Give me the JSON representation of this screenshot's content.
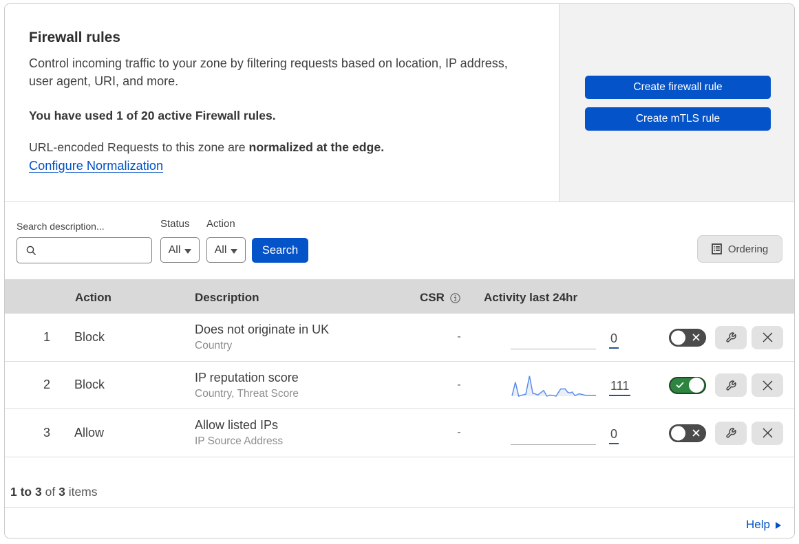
{
  "header": {
    "title": "Firewall rules",
    "description": "Control incoming traffic to your zone by filtering requests based on location, IP address,\nuser agent, URI, and more.",
    "usage_note": "You have used 1 of 20 active Firewall rules.",
    "normalization_prefix": "URL-encoded Requests to this zone are ",
    "normalization_bold": "normalized at the edge.",
    "normalization_link": "Configure Normalization",
    "create_firewall_button": "Create firewall rule",
    "create_mtls_button": "Create mTLS rule"
  },
  "filters": {
    "search_placeholder": "Search description...",
    "search_value": "",
    "status_label": "Status",
    "status_value": "All",
    "action_label": "Action",
    "action_value": "All",
    "search_button": "Search",
    "ordering_button": "Ordering"
  },
  "table": {
    "columns": {
      "action": "Action",
      "description": "Description",
      "csr": "CSR",
      "activity": "Activity last 24hr"
    },
    "rows": [
      {
        "index": "1",
        "action": "Block",
        "description": "Does not originate in UK",
        "criteria": "Country",
        "csr": "-",
        "activity_count": "0",
        "enabled": false
      },
      {
        "index": "2",
        "action": "Block",
        "description": "IP reputation score",
        "criteria": "Country, Threat Score",
        "csr": "-",
        "activity_count": "111",
        "enabled": true
      },
      {
        "index": "3",
        "action": "Allow",
        "description": "Allow listed IPs",
        "criteria": "IP Source Address",
        "csr": "-",
        "activity_count": "0",
        "enabled": false
      }
    ]
  },
  "chart_data": {
    "type": "area",
    "title": "Activity last 24hr sparkline for rule 2 (IP reputation score)",
    "x_range": [
      0,
      124
    ],
    "y_range": [
      0,
      35
    ],
    "baseline_y": 35,
    "line_color": "#5b8dea",
    "fill_color": "#e9eef7",
    "points": [
      [
        2,
        34.6
      ],
      [
        6.9,
        14.7
      ],
      [
        11.7,
        35
      ],
      [
        18.9,
        32.8
      ],
      [
        22,
        32.2
      ],
      [
        27.4,
        5.7
      ],
      [
        32.2,
        31
      ],
      [
        35.8,
        31.6
      ],
      [
        39.4,
        33.4
      ],
      [
        47.9,
        26.8
      ],
      [
        52.7,
        35
      ],
      [
        56.9,
        33.4
      ],
      [
        61.2,
        34
      ],
      [
        66,
        35
      ],
      [
        72.6,
        24.6
      ],
      [
        79.2,
        24.4
      ],
      [
        82.8,
        29.2
      ],
      [
        86.4,
        30.4
      ],
      [
        89.4,
        28.9
      ],
      [
        93.6,
        34.3
      ],
      [
        99.1,
        31.6
      ],
      [
        103.9,
        32.5
      ],
      [
        108.7,
        33.8
      ],
      [
        124,
        34
      ]
    ]
  },
  "footer": {
    "range_label": "1 to 3",
    "of_label": "of",
    "total": "3",
    "items_label": "items",
    "help_label": "Help"
  },
  "colors": {
    "primary_blue": "#0553c8",
    "link_blue": "#0051c3",
    "toggle_on_green": "#2e8540",
    "toggle_off_gray": "#4b4b4b",
    "header_gray": "#d9d9d9",
    "panel_gray": "#f2f2f2"
  }
}
